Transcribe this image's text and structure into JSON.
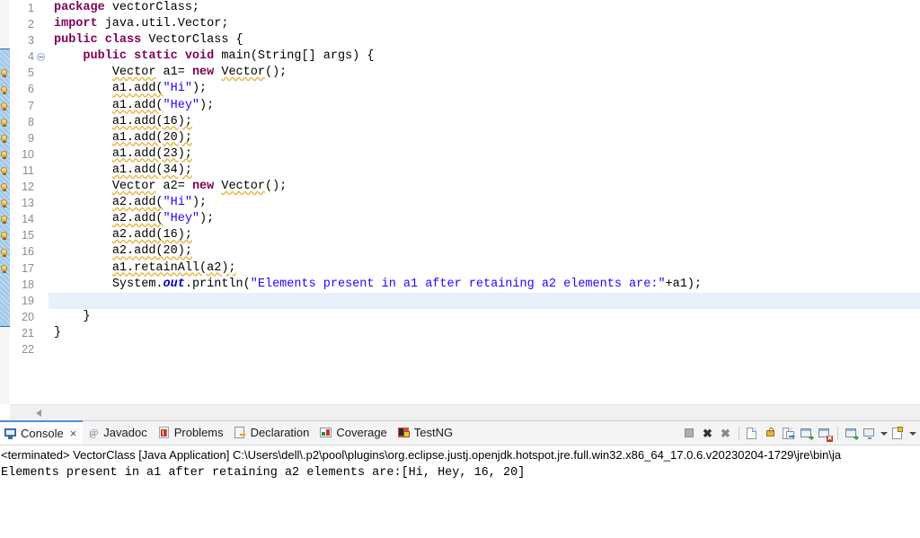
{
  "editor": {
    "language": "java",
    "current_line": 19,
    "lines": [
      {
        "n": 1,
        "warn": false,
        "fold": false,
        "tokens": [
          {
            "t": "package",
            "c": "kw"
          },
          {
            "t": " vectorClass;",
            "c": "plain"
          }
        ]
      },
      {
        "n": 2,
        "warn": false,
        "fold": false,
        "tokens": [
          {
            "t": "import",
            "c": "kw"
          },
          {
            "t": " java.util.Vector;",
            "c": "plain"
          }
        ]
      },
      {
        "n": 3,
        "warn": false,
        "fold": false,
        "tokens": [
          {
            "t": "public class",
            "c": "kw"
          },
          {
            "t": " VectorClass {",
            "c": "plain"
          }
        ]
      },
      {
        "n": 4,
        "warn": false,
        "fold": true,
        "tokens": [
          {
            "t": "    ",
            "c": "plain"
          },
          {
            "t": "public static void",
            "c": "kw"
          },
          {
            "t": " main(String[] args) {",
            "c": "plain"
          }
        ]
      },
      {
        "n": 5,
        "warn": true,
        "fold": false,
        "tokens": [
          {
            "t": "        ",
            "c": "plain"
          },
          {
            "t": "Vector",
            "c": "warnu"
          },
          {
            "t": " a1= ",
            "c": "plain"
          },
          {
            "t": "new",
            "c": "kw"
          },
          {
            "t": " ",
            "c": "plain"
          },
          {
            "t": "Vector",
            "c": "warnu"
          },
          {
            "t": "();",
            "c": "plain"
          }
        ]
      },
      {
        "n": 6,
        "warn": true,
        "fold": false,
        "tokens": [
          {
            "t": "        ",
            "c": "plain"
          },
          {
            "t": "a1.add(",
            "c": "warnu"
          },
          {
            "t": "\"Hi\"",
            "c": "str"
          },
          {
            "t": ");",
            "c": "plain"
          }
        ]
      },
      {
        "n": 7,
        "warn": true,
        "fold": false,
        "tokens": [
          {
            "t": "        ",
            "c": "plain"
          },
          {
            "t": "a1.add(",
            "c": "warnu"
          },
          {
            "t": "\"Hey\"",
            "c": "str"
          },
          {
            "t": ");",
            "c": "plain"
          }
        ]
      },
      {
        "n": 8,
        "warn": true,
        "fold": false,
        "tokens": [
          {
            "t": "        ",
            "c": "plain"
          },
          {
            "t": "a1.add(16);",
            "c": "warnu"
          }
        ]
      },
      {
        "n": 9,
        "warn": true,
        "fold": false,
        "tokens": [
          {
            "t": "        ",
            "c": "plain"
          },
          {
            "t": "a1.add(20);",
            "c": "warnu"
          }
        ]
      },
      {
        "n": 10,
        "warn": true,
        "fold": false,
        "tokens": [
          {
            "t": "        ",
            "c": "plain"
          },
          {
            "t": "a1.add(23);",
            "c": "warnu"
          }
        ]
      },
      {
        "n": 11,
        "warn": true,
        "fold": false,
        "tokens": [
          {
            "t": "        ",
            "c": "plain"
          },
          {
            "t": "a1.add(34);",
            "c": "warnu"
          }
        ]
      },
      {
        "n": 12,
        "warn": true,
        "fold": false,
        "tokens": [
          {
            "t": "        ",
            "c": "plain"
          },
          {
            "t": "Vector",
            "c": "warnu"
          },
          {
            "t": " a2= ",
            "c": "plain"
          },
          {
            "t": "new",
            "c": "kw"
          },
          {
            "t": " ",
            "c": "plain"
          },
          {
            "t": "Vector",
            "c": "warnu"
          },
          {
            "t": "();",
            "c": "plain"
          }
        ]
      },
      {
        "n": 13,
        "warn": true,
        "fold": false,
        "tokens": [
          {
            "t": "        ",
            "c": "plain"
          },
          {
            "t": "a2.add(",
            "c": "warnu"
          },
          {
            "t": "\"Hi\"",
            "c": "str"
          },
          {
            "t": ");",
            "c": "plain"
          }
        ]
      },
      {
        "n": 14,
        "warn": true,
        "fold": false,
        "tokens": [
          {
            "t": "        ",
            "c": "plain"
          },
          {
            "t": "a2.add(",
            "c": "warnu"
          },
          {
            "t": "\"Hey\"",
            "c": "str"
          },
          {
            "t": ");",
            "c": "plain"
          }
        ]
      },
      {
        "n": 15,
        "warn": true,
        "fold": false,
        "tokens": [
          {
            "t": "        ",
            "c": "plain"
          },
          {
            "t": "a2.add(16);",
            "c": "warnu"
          }
        ]
      },
      {
        "n": 16,
        "warn": true,
        "fold": false,
        "tokens": [
          {
            "t": "        ",
            "c": "plain"
          },
          {
            "t": "a2.add(20);",
            "c": "warnu"
          }
        ]
      },
      {
        "n": 17,
        "warn": true,
        "fold": false,
        "tokens": [
          {
            "t": "        ",
            "c": "plain"
          },
          {
            "t": "a1.retainAll(a2);",
            "c": "warnu"
          }
        ]
      },
      {
        "n": 18,
        "warn": false,
        "fold": false,
        "tokens": [
          {
            "t": "        ",
            "c": "plain"
          },
          {
            "t": "System.",
            "c": "plain"
          },
          {
            "t": "out",
            "c": "fieldst"
          },
          {
            "t": ".println(",
            "c": "plain"
          },
          {
            "t": "\"Elements present in a1 after retaining a2 elements are:\"",
            "c": "str"
          },
          {
            "t": "+a1);",
            "c": "plain"
          }
        ]
      },
      {
        "n": 19,
        "warn": false,
        "fold": false,
        "tokens": [
          {
            "t": "        ",
            "c": "plain"
          }
        ]
      },
      {
        "n": 20,
        "warn": false,
        "fold": false,
        "tokens": [
          {
            "t": "    }",
            "c": "plain"
          }
        ]
      },
      {
        "n": 21,
        "warn": false,
        "fold": false,
        "tokens": [
          {
            "t": "}",
            "c": "plain"
          }
        ]
      },
      {
        "n": 22,
        "warn": false,
        "fold": false,
        "tokens": []
      }
    ],
    "scrollbar": {
      "left_arrow": "scroll-left"
    }
  },
  "bottom_panel": {
    "tabs": [
      {
        "id": "console",
        "label": "Console",
        "icon": "console-icon",
        "active": true,
        "closable": true,
        "close_glyph": "×"
      },
      {
        "id": "javadoc",
        "label": "Javadoc",
        "icon": "javadoc-icon",
        "active": false,
        "closable": false,
        "close_glyph": ""
      },
      {
        "id": "problems",
        "label": "Problems",
        "icon": "problems-icon",
        "active": false,
        "closable": false,
        "close_glyph": ""
      },
      {
        "id": "declaration",
        "label": "Declaration",
        "icon": "declaration-icon",
        "active": false,
        "closable": false,
        "close_glyph": ""
      },
      {
        "id": "coverage",
        "label": "Coverage",
        "icon": "coverage-icon",
        "active": false,
        "closable": false,
        "close_glyph": ""
      },
      {
        "id": "testng",
        "label": "TestNG",
        "icon": "testng-icon",
        "active": false,
        "closable": false,
        "close_glyph": ""
      }
    ],
    "toolbar": [
      {
        "kind": "button",
        "name": "terminate-button",
        "glyph": "stop"
      },
      {
        "kind": "button",
        "name": "remove-launch-button",
        "glyph": "x"
      },
      {
        "kind": "button",
        "name": "remove-all-launches-button",
        "glyph": "xx"
      },
      {
        "kind": "sep",
        "name": "toolbar-separator-1",
        "glyph": ""
      },
      {
        "kind": "button",
        "name": "clear-console-button",
        "glyph": "doc-clear"
      },
      {
        "kind": "button",
        "name": "scroll-lock-button",
        "glyph": "lock"
      },
      {
        "kind": "button",
        "name": "word-wrap-button",
        "glyph": "doc-wrap"
      },
      {
        "kind": "button",
        "name": "show-console-on-output-button",
        "glyph": "win-out"
      },
      {
        "kind": "button",
        "name": "show-console-on-error-button",
        "glyph": "win-err"
      },
      {
        "kind": "sep",
        "name": "toolbar-separator-2",
        "glyph": ""
      },
      {
        "kind": "button",
        "name": "pin-console-button",
        "glyph": "pin"
      },
      {
        "kind": "button",
        "name": "display-selected-console-button",
        "glyph": "display"
      },
      {
        "kind": "caret",
        "name": "display-console-dropdown",
        "glyph": "caret"
      },
      {
        "kind": "button",
        "name": "open-console-button",
        "glyph": "new-console"
      },
      {
        "kind": "caret",
        "name": "open-console-dropdown",
        "glyph": "caret"
      }
    ],
    "console": {
      "launch_line": "<terminated> VectorClass [Java Application] C:\\Users\\dell\\.p2\\pool\\plugins\\org.eclipse.justj.openjdk.hotspot.jre.full.win32.x86_64_17.0.6.v20230204-1729\\jre\\bin\\ja",
      "output": "Elements present in a1 after retaining a2 elements are:[Hi, Hey, 16, 20]"
    }
  },
  "colors": {
    "keyword": "#7f0055",
    "string": "#2a00ff",
    "static_field": "#0000c0",
    "current_line_highlight": "#e8f0fb",
    "warning_underline": "#e8b33c",
    "selection_stripe": "#9ec6e8",
    "tab_active_border": "#4a90d9",
    "panel_background": "#f4f4f4"
  }
}
